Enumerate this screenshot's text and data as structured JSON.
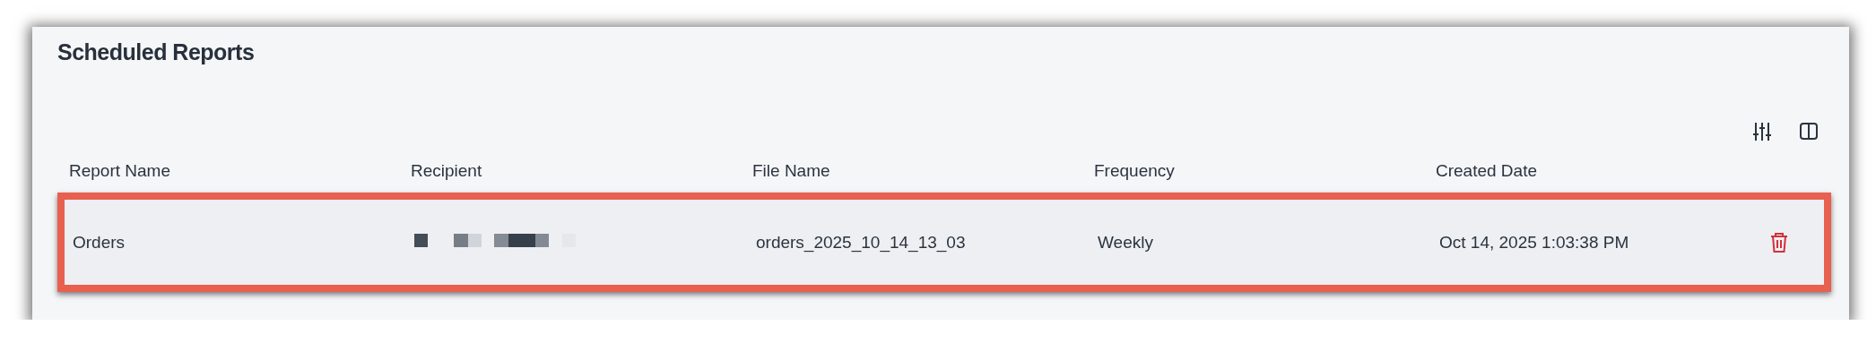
{
  "title": "Scheduled Reports",
  "toolbar": [
    {
      "kind": "filter"
    },
    {
      "kind": "columns"
    }
  ],
  "table": {
    "columns": [
      "Report Name",
      "Recipient",
      "File Name",
      "Frequency",
      "Created Date"
    ],
    "rows": [
      {
        "selected": true,
        "cells": [
          "Orders",
          null,
          "orders_2025_10_14_13_03",
          "Weekly",
          "Oct 14, 2025 1:03:38 PM"
        ],
        "actions": [
          {
            "kind": "delete"
          }
        ]
      }
    ]
  }
}
